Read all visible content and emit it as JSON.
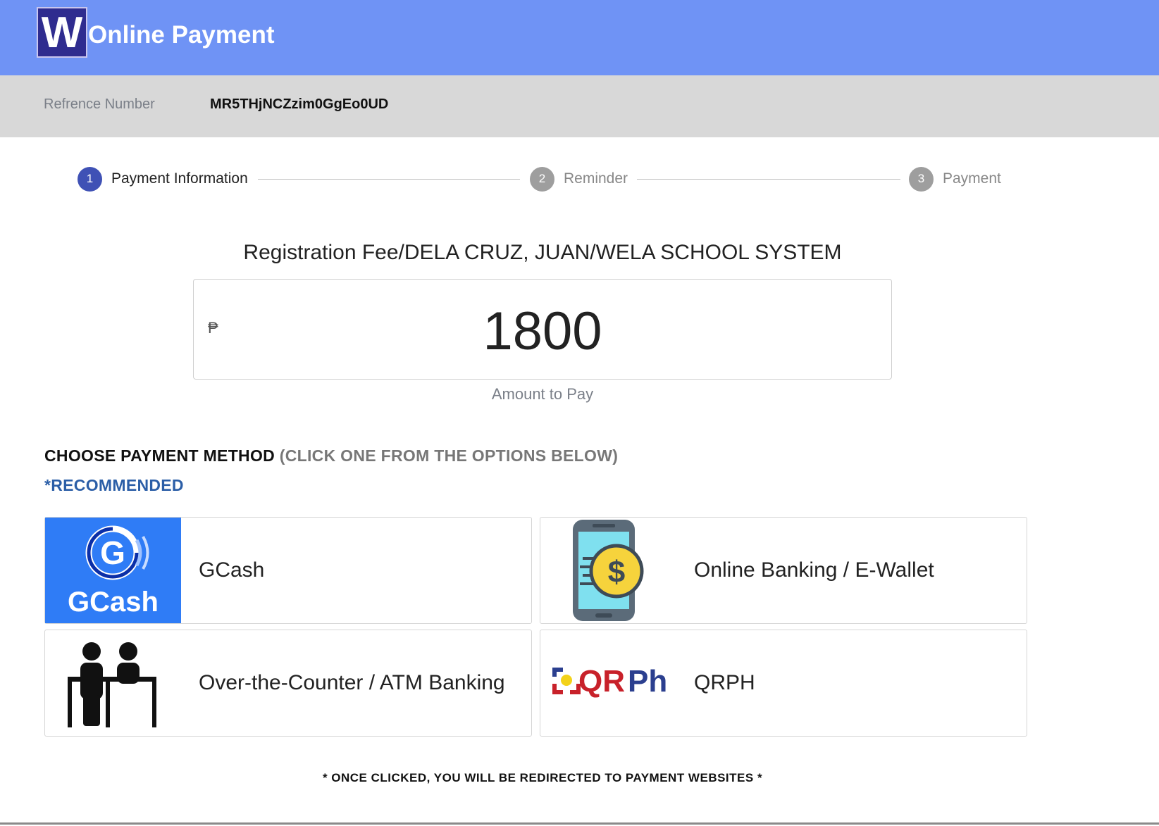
{
  "header": {
    "logo_letter": "W",
    "title": "Online Payment",
    "bg_color": "#6f93f5"
  },
  "reference": {
    "label": "Refrence Number",
    "value": "MR5THjNCZzim0GgEo0UD"
  },
  "steps": [
    {
      "number": "1",
      "label": "Payment Information",
      "active": true
    },
    {
      "number": "2",
      "label": "Reminder",
      "active": false
    },
    {
      "number": "3",
      "label": "Payment",
      "active": false
    }
  ],
  "payment": {
    "description": "Registration Fee/DELA CRUZ, JUAN/WELA SCHOOL SYSTEM",
    "currency_symbol": "₱",
    "amount": "1800",
    "amount_caption": "Amount to Pay"
  },
  "methods_section": {
    "heading": "CHOOSE PAYMENT METHOD",
    "subheading": "(CLICK ONE FROM THE OPTIONS BELOW)",
    "recommended": "*RECOMMENDED"
  },
  "methods": [
    {
      "label": "GCash",
      "logo_text": "GCash",
      "icon": "gcash-logo"
    },
    {
      "label": "Online Banking / E-Wallet",
      "icon": "phone-dollar-icon"
    },
    {
      "label": "Over-the-Counter / ATM Banking",
      "icon": "counter-people-icon"
    },
    {
      "label": "QRPH",
      "logo_text_a": "QR",
      "logo_text_b": "Ph",
      "icon": "qrph-logo"
    }
  ],
  "footer": {
    "note": "* ONCE CLICKED, YOU WILL BE REDIRECTED TO PAYMENT WEBSITES *"
  },
  "colors": {
    "accent": "#3f51b5",
    "recommended": "#2b5ea7",
    "gcash_blue": "#2f7cf6"
  }
}
